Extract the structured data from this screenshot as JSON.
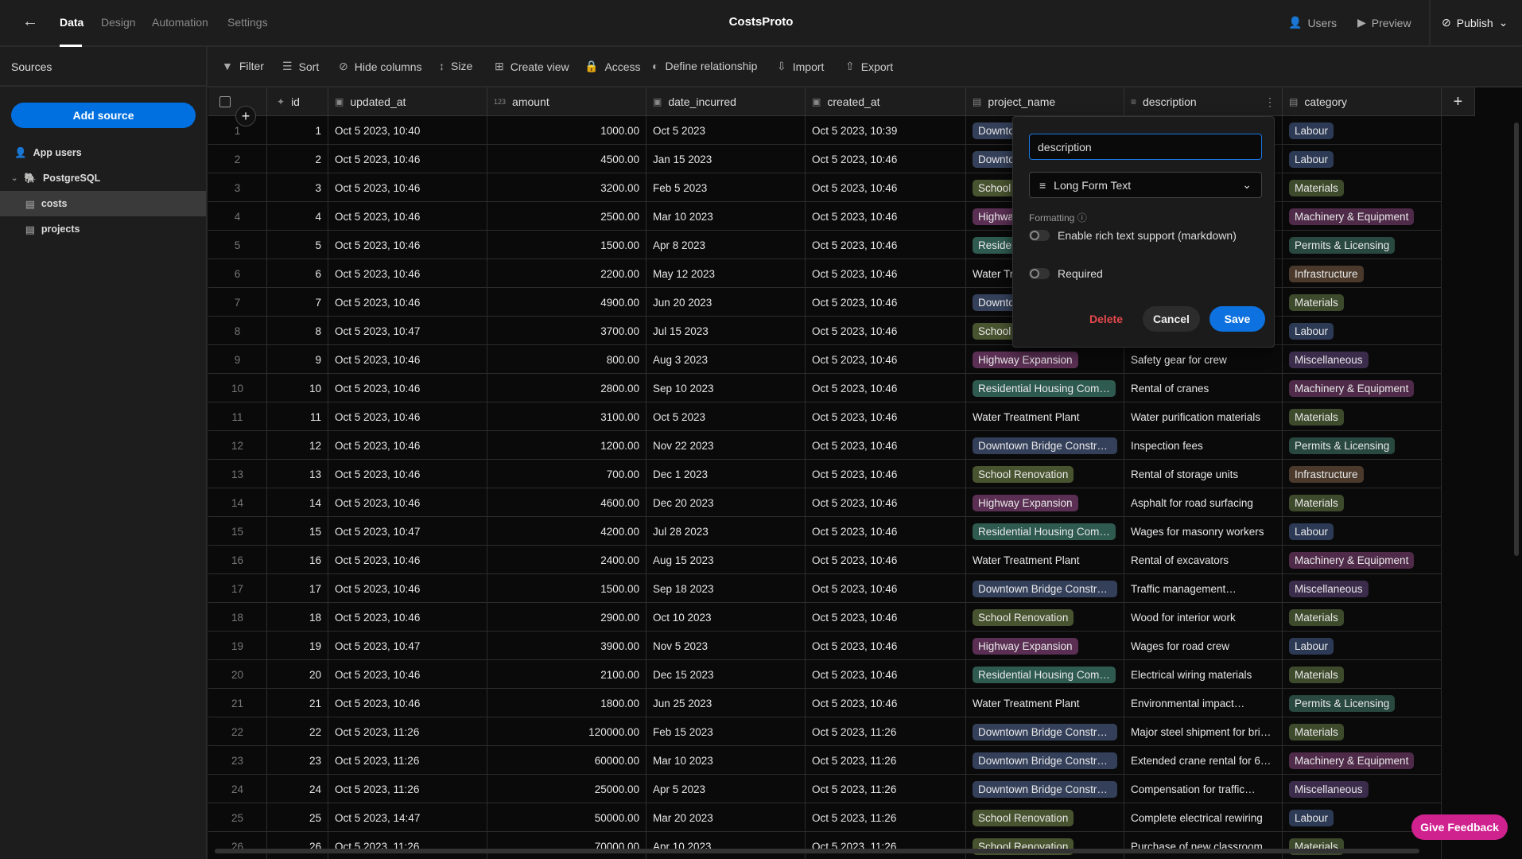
{
  "app": {
    "title": "CostsProto"
  },
  "nav": {
    "tabs": [
      {
        "label": "Data"
      },
      {
        "label": "Design"
      },
      {
        "label": "Automation"
      },
      {
        "label": "Settings"
      }
    ]
  },
  "top_right": {
    "users": "Users",
    "preview": "Preview",
    "publish": "Publish"
  },
  "sidebar": {
    "heading": "Sources",
    "add_source": "Add source",
    "items": [
      {
        "label": "App users"
      },
      {
        "label": "PostgreSQL"
      },
      {
        "label": "costs"
      },
      {
        "label": "projects"
      }
    ]
  },
  "toolbar": {
    "filter": "Filter",
    "sort": "Sort",
    "hide_columns": "Hide columns",
    "size": "Size",
    "create_view": "Create view",
    "access": "Access",
    "define_relationship": "Define relationship",
    "import": "Import",
    "export": "Export"
  },
  "columns": [
    "id",
    "updated_at",
    "amount",
    "date_incurred",
    "created_at",
    "project_name",
    "description",
    "category"
  ],
  "column_type_icons": {
    "amount": "123"
  },
  "tag_colors": {
    "Labour": "#2d3a55",
    "Materials": "#3e4a2c",
    "Machinery & Equipment": "#4f2b49",
    "Permits & Licensing": "#29483f",
    "Infrastructure": "#4b3a2c",
    "Miscellaneous": "#3b2c4c",
    "Downtown Bridge Constru…": "#34405a",
    "Downtown": "#34405a",
    "School Renovation": "#48532f",
    "School": "#48532f",
    "Highway Expansion": "#5a2f53",
    "Highwa": "#5a2f53",
    "Residential Housing Com…": "#2e5a4f",
    "Residen": "#2e5a4f"
  },
  "rows": [
    [
      "1",
      "Oct 5 2023, 10:40",
      "1000.00",
      "Oct 5 2023",
      "Oct 5 2023, 10:39",
      "Downtown",
      "",
      "Labour"
    ],
    [
      "2",
      "Oct 5 2023, 10:46",
      "4500.00",
      "Jan 15 2023",
      "Oct 5 2023, 10:46",
      "Downtown",
      "",
      "Labour"
    ],
    [
      "3",
      "Oct 5 2023, 10:46",
      "3200.00",
      "Feb 5 2023",
      "Oct 5 2023, 10:46",
      "School",
      "",
      "Materials"
    ],
    [
      "4",
      "Oct 5 2023, 10:46",
      "2500.00",
      "Mar 10 2023",
      "Oct 5 2023, 10:46",
      "Highwa",
      "",
      "Machinery & Equipment"
    ],
    [
      "5",
      "Oct 5 2023, 10:46",
      "1500.00",
      "Apr 8 2023",
      "Oct 5 2023, 10:46",
      "Residen",
      "",
      "Permits & Licensing"
    ],
    [
      "6",
      "Oct 5 2023, 10:46",
      "2200.00",
      "May 12 2023",
      "Oct 5 2023, 10:46",
      "Water Tr",
      "",
      "Infrastructure"
    ],
    [
      "7",
      "Oct 5 2023, 10:46",
      "4900.00",
      "Jun 20 2023",
      "Oct 5 2023, 10:46",
      "Downtown",
      "",
      "Materials"
    ],
    [
      "8",
      "Oct 5 2023, 10:47",
      "3700.00",
      "Jul 15 2023",
      "Oct 5 2023, 10:46",
      "School",
      "",
      "Labour"
    ],
    [
      "9",
      "Oct 5 2023, 10:46",
      "800.00",
      "Aug 3 2023",
      "Oct 5 2023, 10:46",
      "Highway Expansion",
      "Safety gear for crew",
      "Miscellaneous"
    ],
    [
      "10",
      "Oct 5 2023, 10:46",
      "2800.00",
      "Sep 10 2023",
      "Oct 5 2023, 10:46",
      "Residential Housing Com…",
      "Rental of cranes",
      "Machinery & Equipment"
    ],
    [
      "11",
      "Oct 5 2023, 10:46",
      "3100.00",
      "Oct 5 2023",
      "Oct 5 2023, 10:46",
      "Water Treatment Plant",
      "Water purification materials",
      "Materials"
    ],
    [
      "12",
      "Oct 5 2023, 10:46",
      "1200.00",
      "Nov 22 2023",
      "Oct 5 2023, 10:46",
      "Downtown Bridge Constru…",
      "Inspection fees",
      "Permits & Licensing"
    ],
    [
      "13",
      "Oct 5 2023, 10:46",
      "700.00",
      "Dec 1 2023",
      "Oct 5 2023, 10:46",
      "School Renovation",
      "Rental of storage units",
      "Infrastructure"
    ],
    [
      "14",
      "Oct 5 2023, 10:46",
      "4600.00",
      "Dec 20 2023",
      "Oct 5 2023, 10:46",
      "Highway Expansion",
      "Asphalt for road surfacing",
      "Materials"
    ],
    [
      "15",
      "Oct 5 2023, 10:47",
      "4200.00",
      "Jul 28 2023",
      "Oct 5 2023, 10:46",
      "Residential Housing Com…",
      "Wages for masonry workers",
      "Labour"
    ],
    [
      "16",
      "Oct 5 2023, 10:46",
      "2400.00",
      "Aug 15 2023",
      "Oct 5 2023, 10:46",
      "Water Treatment Plant",
      "Rental of excavators",
      "Machinery & Equipment"
    ],
    [
      "17",
      "Oct 5 2023, 10:46",
      "1500.00",
      "Sep 18 2023",
      "Oct 5 2023, 10:46",
      "Downtown Bridge Constru…",
      "Traffic management…",
      "Miscellaneous"
    ],
    [
      "18",
      "Oct 5 2023, 10:46",
      "2900.00",
      "Oct 10 2023",
      "Oct 5 2023, 10:46",
      "School Renovation",
      "Wood for interior work",
      "Materials"
    ],
    [
      "19",
      "Oct 5 2023, 10:47",
      "3900.00",
      "Nov 5 2023",
      "Oct 5 2023, 10:46",
      "Highway Expansion",
      "Wages for road crew",
      "Labour"
    ],
    [
      "20",
      "Oct 5 2023, 10:46",
      "2100.00",
      "Dec 15 2023",
      "Oct 5 2023, 10:46",
      "Residential Housing Com…",
      "Electrical wiring materials",
      "Materials"
    ],
    [
      "21",
      "Oct 5 2023, 10:46",
      "1800.00",
      "Jun 25 2023",
      "Oct 5 2023, 10:46",
      "Water Treatment Plant",
      "Environmental impact…",
      "Permits & Licensing"
    ],
    [
      "22",
      "Oct 5 2023, 11:26",
      "120000.00",
      "Feb 15 2023",
      "Oct 5 2023, 11:26",
      "Downtown Bridge Constru…",
      "Major steel shipment for brid…",
      "Materials"
    ],
    [
      "23",
      "Oct 5 2023, 11:26",
      "60000.00",
      "Mar 10 2023",
      "Oct 5 2023, 11:26",
      "Downtown Bridge Constru…",
      "Extended crane rental for 6…",
      "Machinery & Equipment"
    ],
    [
      "24",
      "Oct 5 2023, 11:26",
      "25000.00",
      "Apr 5 2023",
      "Oct 5 2023, 11:26",
      "Downtown Bridge Constru…",
      "Compensation for traffic…",
      "Miscellaneous"
    ],
    [
      "25",
      "Oct 5 2023, 14:47",
      "50000.00",
      "Mar 20 2023",
      "Oct 5 2023, 11:26",
      "School Renovation",
      "Complete electrical rewiring",
      "Labour"
    ],
    [
      "26",
      "Oct 5 2023, 11:26",
      "70000.00",
      "Apr 10 2023",
      "Oct 5 2023, 11:26",
      "School Renovation",
      "Purchase of new classroom…",
      "Materials"
    ]
  ],
  "popup": {
    "name_value": "description",
    "type_value": "Long Form Text",
    "formatting_label": "Formatting",
    "rich_text_label": "Enable rich text support (markdown)",
    "rich_text_on": false,
    "required_label": "Required",
    "required_on": false,
    "delete": "Delete",
    "cancel": "Cancel",
    "save": "Save"
  },
  "feedback": "Give Feedback"
}
